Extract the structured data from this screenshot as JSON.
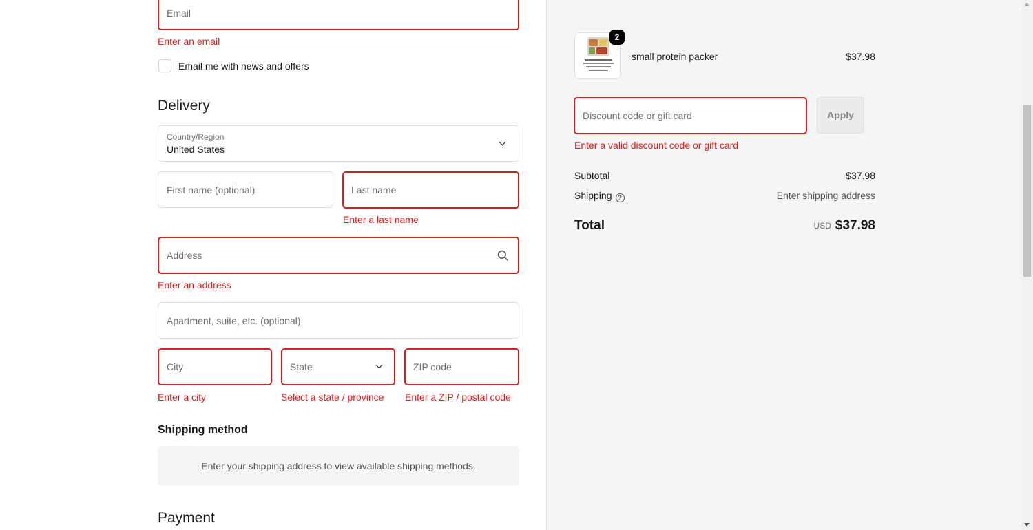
{
  "contact": {
    "email_placeholder": "Email",
    "email_error": "Enter an email",
    "newsletter_label": "Email me with news and offers"
  },
  "delivery": {
    "heading": "Delivery",
    "country_label": "Country/Region",
    "country_value": "United States",
    "first_name_placeholder": "First name (optional)",
    "last_name_placeholder": "Last name",
    "last_name_error": "Enter a last name",
    "address_placeholder": "Address",
    "address_error": "Enter an address",
    "apartment_placeholder": "Apartment, suite, etc. (optional)",
    "city_placeholder": "City",
    "city_error": "Enter a city",
    "state_placeholder": "State",
    "state_error": "Select a state / province",
    "zip_placeholder": "ZIP code",
    "zip_error": "Enter a ZIP / postal code"
  },
  "shipping_method": {
    "heading": "Shipping method",
    "message": "Enter your shipping address to view available shipping methods."
  },
  "payment": {
    "heading": "Payment"
  },
  "order_summary": {
    "product": {
      "name": "small protein packer",
      "price": "$37.98",
      "quantity": "2",
      "image_icon": "product-thumbnail-image"
    },
    "discount": {
      "placeholder": "Discount code or gift card",
      "apply_label": "Apply",
      "error": "Enter a valid discount code or gift card"
    },
    "subtotal_label": "Subtotal",
    "subtotal_value": "$37.98",
    "shipping_label": "Shipping",
    "shipping_value": "Enter shipping address",
    "total_label": "Total",
    "total_currency": "USD",
    "total_value": "$37.98"
  },
  "colors": {
    "error": "#dd1d1d",
    "summary_bg": "#f5f5f5"
  }
}
